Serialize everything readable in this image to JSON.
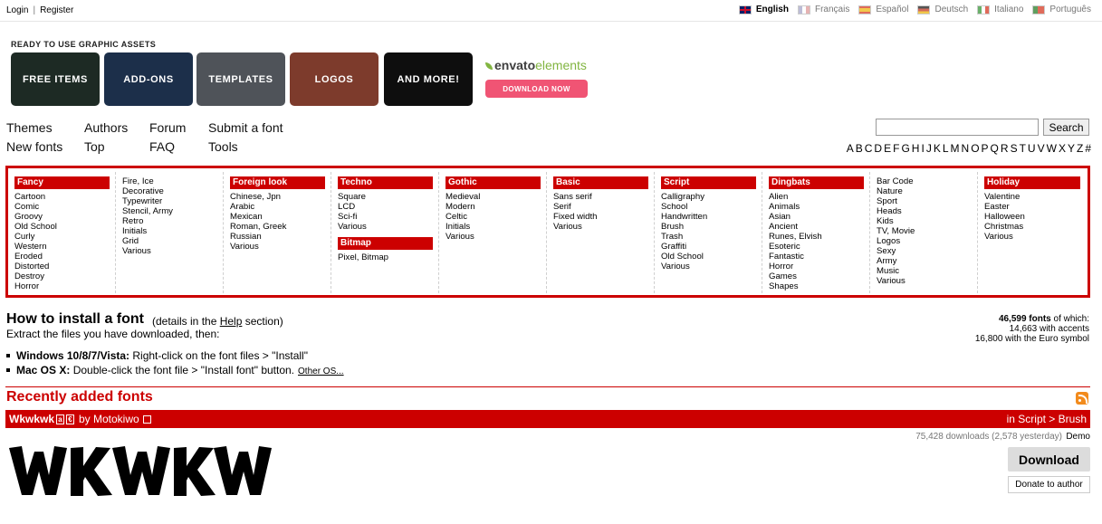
{
  "auth": {
    "login": "Login",
    "register": "Register"
  },
  "languages": [
    {
      "label": "English",
      "active": true
    },
    {
      "label": "Français"
    },
    {
      "label": "Español"
    },
    {
      "label": "Deutsch"
    },
    {
      "label": "Italiano"
    },
    {
      "label": "Português"
    }
  ],
  "banner": {
    "title": "READY TO USE GRAPHIC ASSETS",
    "tiles": [
      "FREE ITEMS",
      "ADD-ONS",
      "TEMPLATES",
      "LOGOS",
      "AND MORE!"
    ],
    "brand_a": "envato",
    "brand_b": "elements",
    "cta": "DOWNLOAD NOW"
  },
  "nav": {
    "themes": "Themes",
    "authors": "Authors",
    "forum": "Forum",
    "submit": "Submit a font",
    "new_fonts": "New fonts",
    "top": "Top",
    "faq": "FAQ",
    "tools": "Tools"
  },
  "search": {
    "placeholder": "",
    "button": "Search"
  },
  "alphabet": [
    "A",
    "B",
    "C",
    "D",
    "E",
    "F",
    "G",
    "H",
    "I",
    "J",
    "K",
    "L",
    "M",
    "N",
    "O",
    "P",
    "Q",
    "R",
    "S",
    "T",
    "U",
    "V",
    "W",
    "X",
    "Y",
    "Z",
    "#"
  ],
  "categories": [
    {
      "head": "Fancy",
      "items": [
        "Cartoon",
        "Comic",
        "Groovy",
        "Old School",
        "Curly",
        "Western",
        "Eroded",
        "Distorted",
        "Destroy",
        "Horror"
      ]
    },
    {
      "items": [
        "Fire, Ice",
        "Decorative",
        "Typewriter",
        "Stencil, Army",
        "Retro",
        "Initials",
        "Grid",
        "Various"
      ]
    },
    {
      "head": "Foreign look",
      "items": [
        "Chinese, Jpn",
        "Arabic",
        "Mexican",
        "Roman, Greek",
        "Russian",
        "Various"
      ]
    },
    {
      "head": "Techno",
      "items": [
        "Square",
        "LCD",
        "Sci-fi",
        "Various"
      ],
      "head2": "Bitmap",
      "items2": [
        "Pixel, Bitmap"
      ]
    },
    {
      "head": "Gothic",
      "items": [
        "Medieval",
        "Modern",
        "Celtic",
        "Initials",
        "Various"
      ]
    },
    {
      "head": "Basic",
      "items": [
        "Sans serif",
        "Serif",
        "Fixed width",
        "Various"
      ]
    },
    {
      "head": "Script",
      "items": [
        "Calligraphy",
        "School",
        "Handwritten",
        "Brush",
        "Trash",
        "Graffiti",
        "Old School",
        "Various"
      ]
    },
    {
      "head": "Dingbats",
      "items": [
        "Alien",
        "Animals",
        "Asian",
        "Ancient",
        "Runes, Elvish",
        "Esoteric",
        "Fantastic",
        "Horror",
        "Games",
        "Shapes"
      ]
    },
    {
      "items": [
        "Bar Code",
        "Nature",
        "Sport",
        "Heads",
        "Kids",
        "TV, Movie",
        "Logos",
        "Sexy",
        "Army",
        "Music",
        "Various"
      ]
    },
    {
      "head": "Holiday",
      "items": [
        "Valentine",
        "Easter",
        "Halloween",
        "Christmas",
        "Various"
      ]
    }
  ],
  "install": {
    "title": "How to install a font",
    "note_prefix": "(details in the ",
    "note_link": "Help",
    "note_suffix": " section)",
    "text": "Extract the files you have downloaded, then:",
    "win_label": "Windows 10/8/7/Vista:",
    "win_text": " Right-click on the font files > \"Install\"",
    "mac_label": "Mac OS X:",
    "mac_text": " Double-click the font file > \"Install font\" button.",
    "other": "Other OS..."
  },
  "stats": {
    "count": "46,599 fonts",
    "of_which": " of which:",
    "accents": "14,663 with accents",
    "euro": "16,800 with the Euro symbol"
  },
  "recent": {
    "title": "Recently added fonts",
    "font_name": "Wkwkwk",
    "badge1": "a",
    "badge2": "€",
    "by": "by Motokiwo",
    "category": "in Script > Brush",
    "downloads": "75,428 downloads (2,578 yesterday)",
    "demo": "Demo",
    "download": "Download",
    "donate": "Donate to author"
  }
}
